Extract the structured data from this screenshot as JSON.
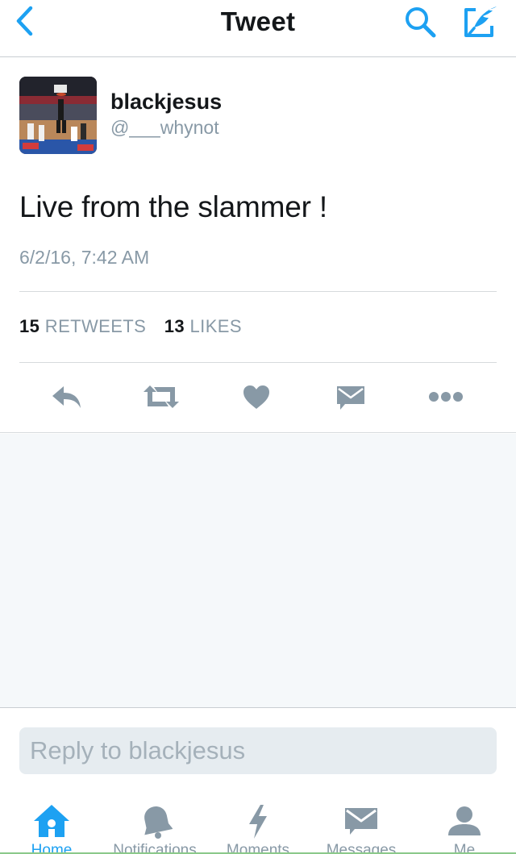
{
  "colors": {
    "accent": "#1da1f2",
    "icon_gray": "#8899a6",
    "text_primary": "#14171a",
    "background_gray": "#f5f8fa"
  },
  "navbar": {
    "title": "Tweet",
    "back_icon": "chevron-left-icon",
    "search_icon": "search-icon",
    "compose_icon": "compose-icon"
  },
  "tweet": {
    "user_name": "blackjesus",
    "user_handle": "@___whynot",
    "text": "Live from the slammer !",
    "timestamp": "6/2/16, 7:42 AM",
    "retweets_count": "15",
    "retweets_label": "RETWEETS",
    "likes_count": "13",
    "likes_label": "LIKES",
    "actions": [
      "reply-icon",
      "retweet-icon",
      "heart-icon",
      "direct-message-icon",
      "more-icon"
    ]
  },
  "reply": {
    "placeholder": "Reply to blackjesus"
  },
  "tabbar": {
    "tabs": [
      {
        "label": "Home",
        "icon": "home-icon",
        "active": true
      },
      {
        "label": "Notifications",
        "icon": "bell-icon",
        "active": false
      },
      {
        "label": "Moments",
        "icon": "lightning-icon",
        "active": false
      },
      {
        "label": "Messages",
        "icon": "envelope-icon",
        "active": false
      },
      {
        "label": "Me",
        "icon": "person-icon",
        "active": false
      }
    ]
  }
}
